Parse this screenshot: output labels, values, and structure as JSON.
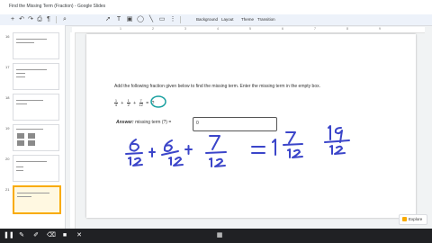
{
  "doc": {
    "title": "Find the Missing Term (Fraction) - Google Slides"
  },
  "toolbar": {
    "background_label": "Background",
    "layout_label": "Layout",
    "theme_label": "Theme",
    "transition_label": "Transition"
  },
  "ruler": {
    "marks": [
      "1",
      "2",
      "3",
      "4",
      "5",
      "6",
      "7",
      "8",
      "9"
    ]
  },
  "filmstrip": {
    "slide_numbers": [
      "16",
      "17",
      "18",
      "19",
      "20",
      "21"
    ],
    "active_slide": "21"
  },
  "slide": {
    "question": "Add the following fraction given below to find the missing term. Enter the missing term in the empty box.",
    "equation": {
      "terms": [
        {
          "num": "1",
          "den": "4"
        },
        {
          "num": "1",
          "den": "2"
        },
        {
          "num": "7",
          "den": "12"
        }
      ]
    },
    "answer_label": "Answer:",
    "answer_text": "missing term (?) =",
    "answer_value": "0"
  },
  "explore": {
    "label": "Explore"
  },
  "colors": {
    "ink": "#3b45c9",
    "circle": "#1aa0a0",
    "active_border": "#f9ab00"
  }
}
